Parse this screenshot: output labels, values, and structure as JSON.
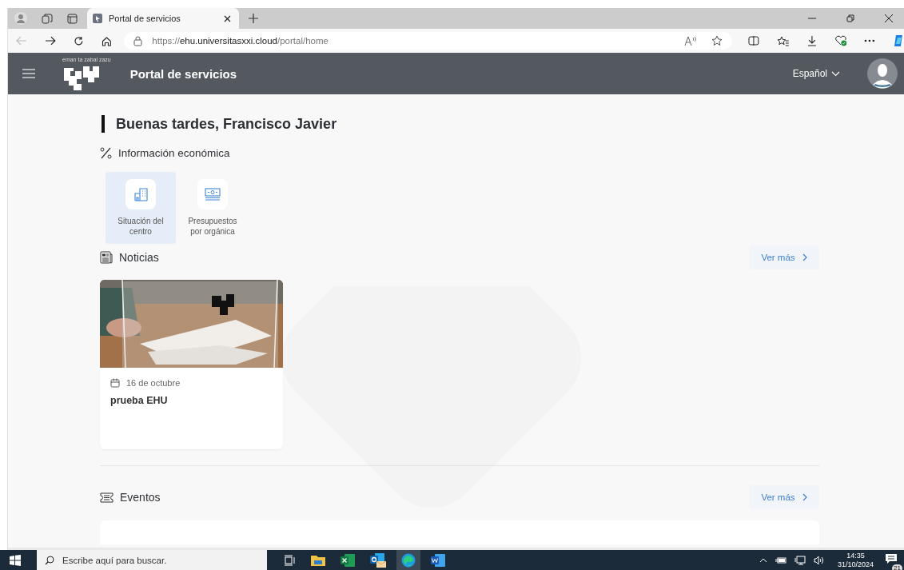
{
  "browser": {
    "tabs": [
      {
        "title": "Portal de servicios",
        "selected": true
      }
    ],
    "url_prefix": "https://",
    "url_host": "ehu.universitasxxi.cloud",
    "url_path": "/portal/home"
  },
  "app_header": {
    "motto": "eman ta zabal zazu",
    "title": "Portal de servicios",
    "language": "Español"
  },
  "greeting": "Buenas tardes, Francisco Javier",
  "economic": {
    "title": "Información económica",
    "items": [
      {
        "label": "Situación del centro",
        "kind": "building",
        "selected": true
      },
      {
        "label": "Presupuestos por orgánica",
        "kind": "money",
        "selected": false
      }
    ]
  },
  "news": {
    "title": "Noticias",
    "more": "Ver más",
    "items": [
      {
        "date": "16 de octubre",
        "title": "prueba EHU"
      }
    ]
  },
  "events": {
    "title": "Eventos",
    "more": "Ver más"
  },
  "taskbar": {
    "search_placeholder": "Escribe aquí para buscar.",
    "time": "14:35",
    "date": "31/10/2024",
    "notifications": "21"
  }
}
